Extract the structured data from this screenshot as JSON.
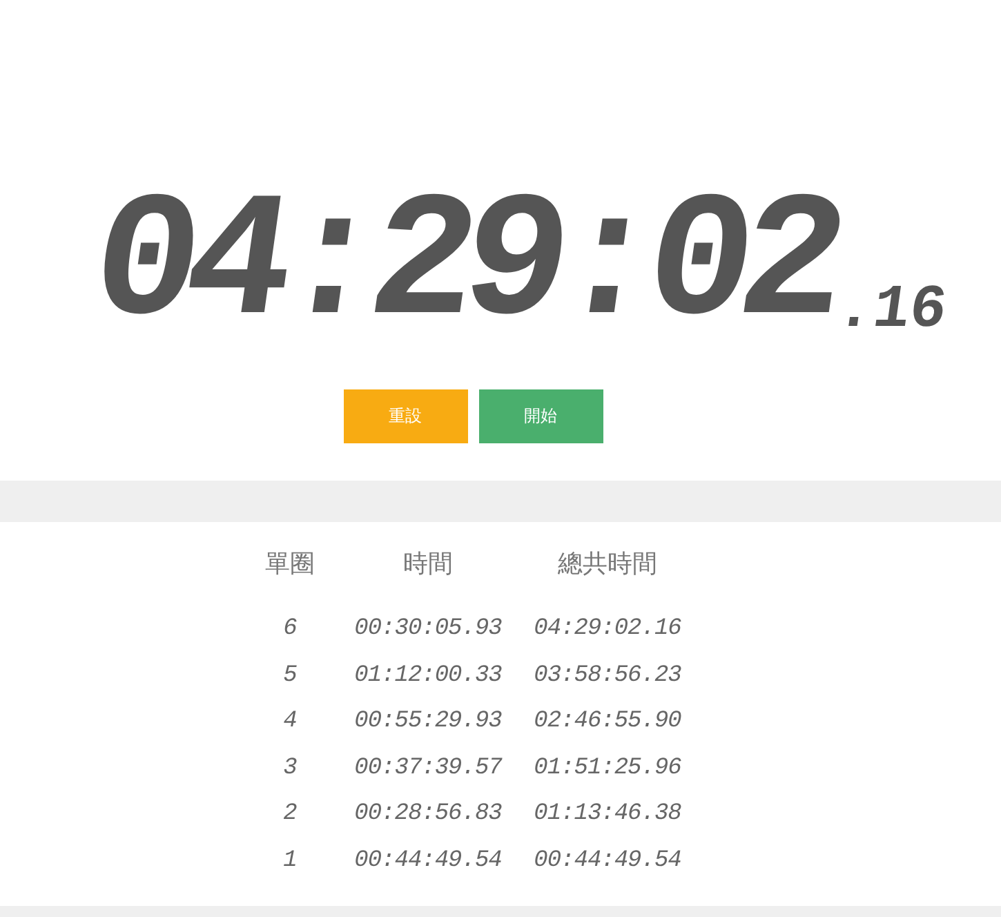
{
  "display": {
    "main": "04:29:02",
    "fraction": ".16"
  },
  "buttons": [
    {
      "label": "重設",
      "kind": "reset"
    },
    {
      "label": "開始",
      "kind": "start"
    }
  ],
  "laps": {
    "columns": [
      "單圈",
      "時間",
      "總共時間"
    ],
    "rows": [
      {
        "lap": "6",
        "time": "00:30:05.93",
        "total": "04:29:02.16"
      },
      {
        "lap": "5",
        "time": "01:12:00.33",
        "total": "03:58:56.23"
      },
      {
        "lap": "4",
        "time": "00:55:29.93",
        "total": "02:46:55.90"
      },
      {
        "lap": "3",
        "time": "00:37:39.57",
        "total": "01:51:25.96"
      },
      {
        "lap": "2",
        "time": "00:28:56.83",
        "total": "01:13:46.38"
      },
      {
        "lap": "1",
        "time": "00:44:49.54",
        "total": "00:44:49.54"
      }
    ]
  }
}
